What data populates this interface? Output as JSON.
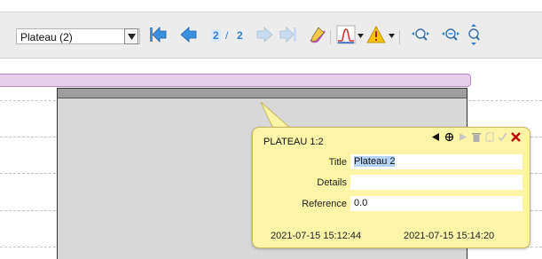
{
  "toolbar": {
    "plateau_select": {
      "value": "Plateau (2)"
    },
    "navigation": {
      "current_page": "2",
      "separator": "/",
      "total_pages": "2"
    },
    "icons": [
      "dropdown-icon",
      "first-icon",
      "previous-icon",
      "next-icon",
      "last-icon",
      "edit-marker-icon",
      "chart-icon",
      "warning-icon",
      "zoom-fit-icon",
      "zoom-out-icon",
      "zoom-in-icon"
    ]
  },
  "popup": {
    "title": "PLATEAU 1:2",
    "fields": {
      "title_label": "Title",
      "title_value": "Plateau 2",
      "details_label": "Details",
      "details_value": "",
      "reference_label": "Reference",
      "reference_value": "0.0"
    },
    "start_time": "2021-07-15 15:12:44",
    "end_time": "2021-07-15 15:14:20"
  },
  "colors": {
    "nav_blue": "#2f7fd6",
    "popup_bg": "#fcf4a6",
    "plateau_bar": "#e7cfee",
    "delete_red": "#c00000"
  }
}
